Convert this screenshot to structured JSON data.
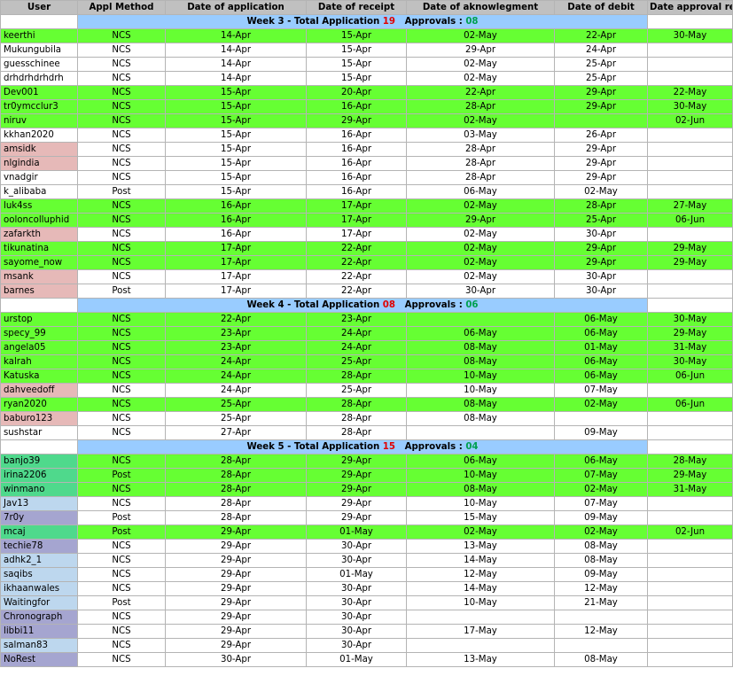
{
  "headers": [
    "User",
    "Appl Method",
    "Date of application",
    "Date of receipt",
    "Date of aknowlegment",
    "Date of debit",
    "Date approval received"
  ],
  "sections": [
    {
      "title_prefix": "Week 3 - Total Application ",
      "total": "19",
      "approvals_label": "Approvals : ",
      "approvals": "08",
      "rows": [
        {
          "c": "g",
          "user_c": "g",
          "cells": [
            "keerthi",
            "NCS",
            "14-Apr",
            "15-Apr",
            "02-May",
            "22-Apr",
            "30-May"
          ]
        },
        {
          "c": "w",
          "user_c": "w",
          "cells": [
            "Mukungubila",
            "NCS",
            "14-Apr",
            "15-Apr",
            "29-Apr",
            "24-Apr",
            ""
          ]
        },
        {
          "c": "w",
          "user_c": "w",
          "cells": [
            "guesschinee",
            "NCS",
            "14-Apr",
            "15-Apr",
            "02-May",
            "25-Apr",
            ""
          ]
        },
        {
          "c": "w",
          "user_c": "w",
          "cells": [
            "drhdrhdrhdrh",
            "NCS",
            "14-Apr",
            "15-Apr",
            "02-May",
            "25-Apr",
            ""
          ]
        },
        {
          "c": "g",
          "user_c": "g",
          "cells": [
            "Dev001",
            "NCS",
            "15-Apr",
            "20-Apr",
            "22-Apr",
            "29-Apr",
            "22-May"
          ]
        },
        {
          "c": "g",
          "user_c": "g",
          "cells": [
            "tr0ymcclur3",
            "NCS",
            "15-Apr",
            "16-Apr",
            "28-Apr",
            "29-Apr",
            "30-May"
          ]
        },
        {
          "c": "g",
          "user_c": "g",
          "cells": [
            "niruv",
            "NCS",
            "15-Apr",
            "29-Apr",
            "02-May",
            "",
            "02-Jun"
          ]
        },
        {
          "c": "w",
          "user_c": "w",
          "cells": [
            "kkhan2020",
            "NCS",
            "15-Apr",
            "16-Apr",
            "03-May",
            "26-Apr",
            ""
          ]
        },
        {
          "c": "w",
          "user_c": "p",
          "cells": [
            "amsidk",
            "NCS",
            "15-Apr",
            "16-Apr",
            "28-Apr",
            "29-Apr",
            ""
          ]
        },
        {
          "c": "w",
          "user_c": "p",
          "cells": [
            "nlgindia",
            "NCS",
            "15-Apr",
            "16-Apr",
            "28-Apr",
            "29-Apr",
            ""
          ]
        },
        {
          "c": "w",
          "user_c": "w",
          "cells": [
            "vnadgir",
            "NCS",
            "15-Apr",
            "16-Apr",
            "28-Apr",
            "29-Apr",
            ""
          ]
        },
        {
          "c": "w",
          "user_c": "w",
          "cells": [
            "k_alibaba",
            "Post",
            "15-Apr",
            "16-Apr",
            "06-May",
            "02-May",
            ""
          ]
        },
        {
          "c": "g",
          "user_c": "g",
          "cells": [
            "luk4ss",
            "NCS",
            "16-Apr",
            "17-Apr",
            "02-May",
            "28-Apr",
            "27-May"
          ]
        },
        {
          "c": "g",
          "user_c": "g",
          "cells": [
            "ooloncolluphid",
            "NCS",
            "16-Apr",
            "17-Apr",
            "29-Apr",
            "25-Apr",
            "06-Jun"
          ]
        },
        {
          "c": "w",
          "user_c": "p",
          "cells": [
            "zafarkth",
            "NCS",
            "16-Apr",
            "17-Apr",
            "02-May",
            "30-Apr",
            ""
          ]
        },
        {
          "c": "g",
          "user_c": "g",
          "cells": [
            "tikunatina",
            "NCS",
            "17-Apr",
            "22-Apr",
            "02-May",
            "29-Apr",
            "29-May"
          ]
        },
        {
          "c": "g",
          "user_c": "g",
          "cells": [
            "sayome_now",
            "NCS",
            "17-Apr",
            "22-Apr",
            "02-May",
            "29-Apr",
            "29-May"
          ]
        },
        {
          "c": "w",
          "user_c": "p",
          "cells": [
            "msank",
            "NCS",
            "17-Apr",
            "22-Apr",
            "02-May",
            "30-Apr",
            ""
          ]
        },
        {
          "c": "w",
          "user_c": "p",
          "cells": [
            "barnes",
            "Post",
            "17-Apr",
            "22-Apr",
            "30-Apr",
            "30-Apr",
            ""
          ]
        }
      ]
    },
    {
      "title_prefix": "Week 4 - Total Application ",
      "total": "08",
      "approvals_label": "Approvals : ",
      "approvals": "06",
      "rows": [
        {
          "c": "g",
          "user_c": "g",
          "cells": [
            "urstop",
            "NCS",
            "22-Apr",
            "23-Apr",
            "",
            "06-May",
            "30-May"
          ]
        },
        {
          "c": "g",
          "user_c": "g",
          "cells": [
            "specy_99",
            "NCS",
            "23-Apr",
            "24-Apr",
            "06-May",
            "06-May",
            "29-May"
          ]
        },
        {
          "c": "g",
          "user_c": "g",
          "cells": [
            "angela05",
            "NCS",
            "23-Apr",
            "24-Apr",
            "08-May",
            "01-May",
            "31-May"
          ]
        },
        {
          "c": "g",
          "user_c": "g",
          "cells": [
            "kalrah",
            "NCS",
            "24-Apr",
            "25-Apr",
            "08-May",
            "06-May",
            "30-May"
          ]
        },
        {
          "c": "g",
          "user_c": "g",
          "cells": [
            "Katuska",
            "NCS",
            "24-Apr",
            "28-Apr",
            "10-May",
            "06-May",
            "06-Jun"
          ]
        },
        {
          "c": "w",
          "user_c": "p",
          "cells": [
            "dahveedoff",
            "NCS",
            "24-Apr",
            "25-Apr",
            "10-May",
            "07-May",
            ""
          ]
        },
        {
          "c": "g",
          "user_c": "g",
          "cells": [
            "ryan2020",
            "NCS",
            "25-Apr",
            "28-Apr",
            "08-May",
            "02-May",
            "06-Jun"
          ]
        },
        {
          "c": "w",
          "user_c": "p",
          "cells": [
            "baburo123",
            "NCS",
            "25-Apr",
            "28-Apr",
            "08-May",
            "",
            ""
          ]
        },
        {
          "c": "w",
          "user_c": "w",
          "cells": [
            "sushstar",
            "NCS",
            "27-Apr",
            "28-Apr",
            "",
            "09-May",
            ""
          ]
        }
      ]
    },
    {
      "title_prefix": "Week 5 - Total Application ",
      "total": "15",
      "approvals_label": "Approvals : ",
      "approvals": "04",
      "rows": [
        {
          "c": "g",
          "user_c": "t",
          "cells": [
            "banjo39",
            "NCS",
            "28-Apr",
            "29-Apr",
            "06-May",
            "06-May",
            "28-May"
          ]
        },
        {
          "c": "g",
          "user_c": "t",
          "cells": [
            "irina2206",
            "Post",
            "28-Apr",
            "29-Apr",
            "10-May",
            "07-May",
            "29-May"
          ]
        },
        {
          "c": "g",
          "user_c": "t",
          "cells": [
            "winmano",
            "NCS",
            "28-Apr",
            "29-Apr",
            "08-May",
            "02-May",
            "31-May"
          ]
        },
        {
          "c": "w",
          "user_c": "b",
          "cells": [
            "Jav13",
            "NCS",
            "28-Apr",
            "29-Apr",
            "10-May",
            "07-May",
            ""
          ]
        },
        {
          "c": "w",
          "user_c": "v",
          "cells": [
            "7r0y",
            "Post",
            "28-Apr",
            "29-Apr",
            "15-May",
            "09-May",
            ""
          ]
        },
        {
          "c": "g",
          "user_c": "t",
          "cells": [
            "mcaj",
            "Post",
            "29-Apr",
            "01-May",
            "02-May",
            "02-May",
            "02-Jun"
          ]
        },
        {
          "c": "w",
          "user_c": "v",
          "cells": [
            "techie78",
            "NCS",
            "29-Apr",
            "30-Apr",
            "13-May",
            "08-May",
            ""
          ]
        },
        {
          "c": "w",
          "user_c": "b",
          "cells": [
            "adhk2_1",
            "NCS",
            "29-Apr",
            "30-Apr",
            "14-May",
            "08-May",
            ""
          ]
        },
        {
          "c": "w",
          "user_c": "b",
          "cells": [
            "saqibs",
            "NCS",
            "29-Apr",
            "01-May",
            "12-May",
            "09-May",
            ""
          ]
        },
        {
          "c": "w",
          "user_c": "b",
          "cells": [
            "ikhaanwales",
            "NCS",
            "29-Apr",
            "30-Apr",
            "14-May",
            "12-May",
            ""
          ]
        },
        {
          "c": "w",
          "user_c": "b",
          "cells": [
            "Waitingfor",
            "Post",
            "29-Apr",
            "30-Apr",
            "10-May",
            "21-May",
            ""
          ]
        },
        {
          "c": "w",
          "user_c": "v",
          "cells": [
            "Chronograph",
            "NCS",
            "29-Apr",
            "30-Apr",
            "",
            "",
            ""
          ]
        },
        {
          "c": "w",
          "user_c": "v",
          "cells": [
            "libbi11",
            "NCS",
            "29-Apr",
            "30-Apr",
            "17-May",
            "12-May",
            ""
          ]
        },
        {
          "c": "w",
          "user_c": "b",
          "cells": [
            "salman83",
            "NCS",
            "29-Apr",
            "30-Apr",
            "",
            "",
            ""
          ]
        },
        {
          "c": "w",
          "user_c": "v",
          "cells": [
            "NoRest",
            "NCS",
            "30-Apr",
            "01-May",
            "13-May",
            "08-May",
            ""
          ]
        }
      ]
    }
  ]
}
